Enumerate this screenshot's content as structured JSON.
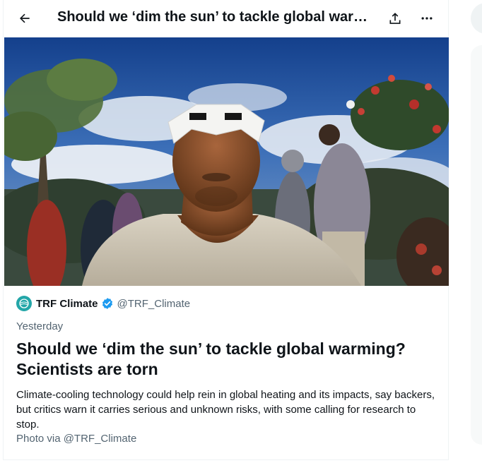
{
  "topbar": {
    "title": "Should we ‘dim the sun’ to tackle global warming? Scientists are torn",
    "back_icon": "arrow-left-icon",
    "share_icon": "share-upload-icon",
    "more_icon": "more-horizontal-icon"
  },
  "hero": {
    "icon": "photo-man-solar-eclipse-glasses"
  },
  "author": {
    "name": "TRF Climate",
    "handle": "@TRF_Climate",
    "avatar_color": "#23a6a8",
    "verified_color": "#1d9bf0"
  },
  "article": {
    "timestamp": "Yesterday",
    "headline": "Should we ‘dim the sun’ to tackle global warming? Scientists are torn",
    "summary": "Climate-cooling technology could help rein in global heating and its impacts, say backers, but critics warn it carries serious and unknown risks, with some calling for research to stop.",
    "credit": "Photo via @TRF_Climate"
  }
}
